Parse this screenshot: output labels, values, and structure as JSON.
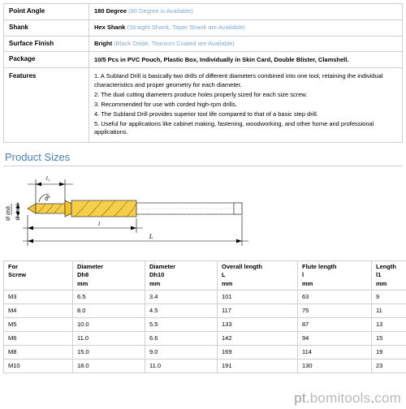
{
  "specs": [
    {
      "label": "Point Angle",
      "main": "180 Degree",
      "note": "(90 Degree is Available)"
    },
    {
      "label": "Shank",
      "main": "Hex Shank",
      "note": "(Straight Shank, Taper Shank are Available)"
    },
    {
      "label": "Surface Finish",
      "main": "Bright",
      "note": "(Black Oxide, Titanium Coated are Available)"
    },
    {
      "label": "Package",
      "main": "10/5 Pcs in PVC Pouch, Plastic Box, Individually in Skin Card, Double Blister, Clamshell.",
      "note": ""
    }
  ],
  "features": {
    "label": "Features",
    "items": [
      "1. A Subland Drill is basically two drills of different diameters combined into one tool, retaining the individual characteristics and proper geometry for each diameter.",
      "2. The dual cutting diameters produce holes properly sized for each size screw.",
      "3. Recommended for use with corded high-rpm drills.",
      "4. The Subland Drill provides superior tool life compared to that of a basic step drill.",
      "5. Useful for applications like cabinet making, fastening, woodworking, and other home and professional applications."
    ]
  },
  "section": {
    "title": "Product Sizes"
  },
  "diagram": {
    "labels": {
      "l1": "l1",
      "angle": "06",
      "l": "l",
      "L": "L",
      "dh8": "Ø dh8",
      "dh10": "Ø dh10"
    }
  },
  "size_table": {
    "headers": [
      {
        "line1": "For",
        "line2": "Screw",
        "unit": ""
      },
      {
        "line1": "Diameter",
        "line2": "Dh8",
        "unit": "mm"
      },
      {
        "line1": "Diameter",
        "line2": "Dh10",
        "unit": "mm"
      },
      {
        "line1": "Overall length",
        "line2": "L",
        "unit": "mm"
      },
      {
        "line1": "Flute length",
        "line2": "l",
        "unit": "mm"
      },
      {
        "line1": "Length",
        "line2": "l1",
        "unit": "mm"
      }
    ],
    "rows": [
      [
        "M3",
        "6.5",
        "3.4",
        "101",
        "63",
        "9"
      ],
      [
        "M4",
        "8.0",
        "4.5",
        "117",
        "75",
        "11"
      ],
      [
        "M5",
        "10.0",
        "5.5",
        "133",
        "87",
        "13"
      ],
      [
        "M6",
        "11.0",
        "6.6",
        "142",
        "94",
        "15"
      ],
      [
        "M8",
        "15.0",
        "9.0",
        "169",
        "114",
        "19"
      ],
      [
        "M10",
        "18.0",
        "11.0",
        "191",
        "130",
        "23"
      ]
    ]
  },
  "watermark": {
    "prefix": "pt.",
    "brand": "bomitools",
    "dot": ".",
    "tld": "com"
  }
}
